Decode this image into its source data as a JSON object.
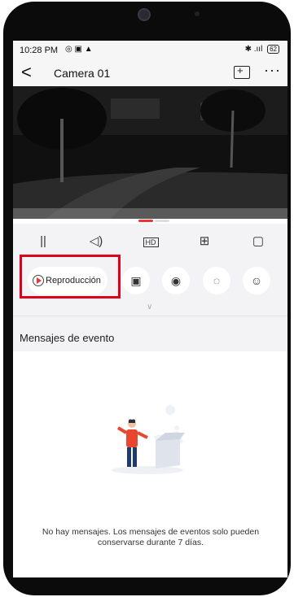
{
  "status_bar": {
    "time": "10:28 PM",
    "left_icons": "◎ ▣ ▲",
    "right_icons": "✱ .ııl",
    "battery": "62"
  },
  "header": {
    "back_label": "<",
    "title": "Camera 01",
    "more_label": "···"
  },
  "toolbar": {
    "pause_label": "||",
    "volume_label": "◁)",
    "hd_label": "HD",
    "grid_label": "⊞",
    "window_label": "▢"
  },
  "actions": {
    "playback_label": "Reproducción",
    "snapshot_label": "▣",
    "record_label": "◉",
    "mic_label": "◌",
    "ptz_label": "☺"
  },
  "chevron": "∨",
  "events": {
    "title": "Mensajes de evento",
    "empty_message": "No hay mensajes. Los mensajes de eventos solo pueden conservarse durante 7 días."
  },
  "colors": {
    "accent": "#e33333",
    "highlight": "#e0001b",
    "background": "#f3f3f5"
  }
}
